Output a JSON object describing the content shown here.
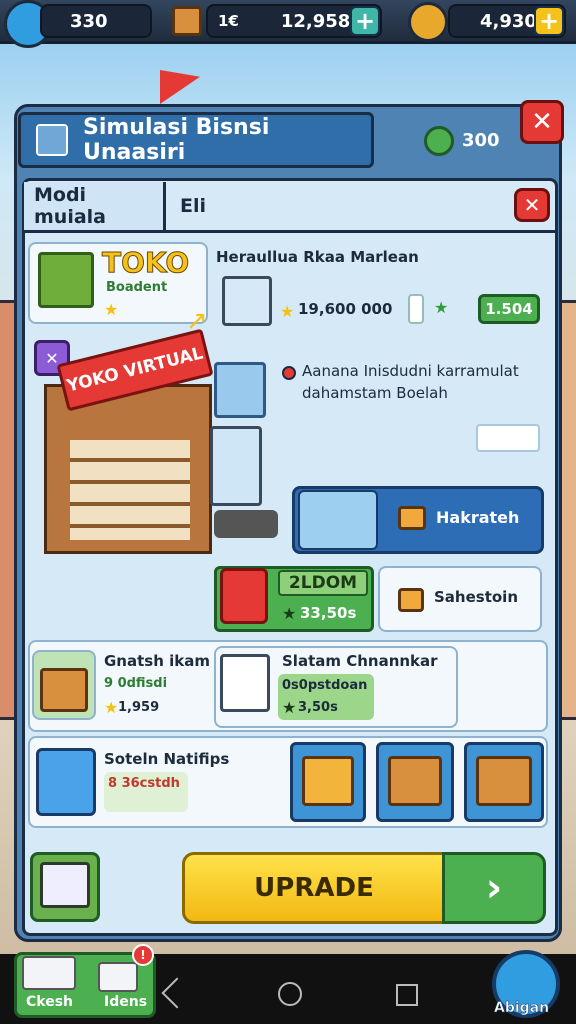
{
  "top_bar": {
    "resource_1": "330",
    "resource_2_icon_label": "1€",
    "resource_2": "12,958",
    "resource_3": "4,930",
    "plus": "+"
  },
  "window": {
    "title": "Simulasi Bisnsi Unaasiri",
    "coins": "300",
    "close": "✕"
  },
  "tabs": {
    "tab_1": "Modi muiala",
    "tab_2": "Eli",
    "close": "✕"
  },
  "shop": {
    "logo": "TOKO",
    "logo_sub": "Boadent",
    "sign": "YOKO VIRTUAL",
    "x_badge": "✕",
    "cart_title": "Heraullua Rkaa Marlean",
    "cart_price": "19,600 000",
    "cart_value": "1.504",
    "desc_line_1": "Aanana Inisdudni karramulat",
    "desc_line_2": "dahamstam Boelah",
    "feature_btn": "Hakrateh",
    "upgrade_label": "2LDOM",
    "upgrade_cost": "33,50s",
    "secondary_btn": "Sahestoin"
  },
  "items": [
    {
      "name": "Gnatsh ikam",
      "sub": "9 0dfisdi",
      "cost": "1,959"
    },
    {
      "name": "Slatam Chnannkar",
      "sub": "0s0pstdoan",
      "cost": "3,50s"
    },
    {
      "name": "Soteln Natifips",
      "sub": "8 36cstdh"
    }
  ],
  "upgrade_button": "UPRADE",
  "upgrade_arrow": "›",
  "bottom": {
    "btn_1": "Ckesh",
    "btn_2": "Idens",
    "badge": "!",
    "right_btn": "Abigan"
  },
  "colors": {
    "accent_blue": "#2f6ea8",
    "green": "#4caf50",
    "yellow": "#f6c21a",
    "red": "#e53935"
  }
}
